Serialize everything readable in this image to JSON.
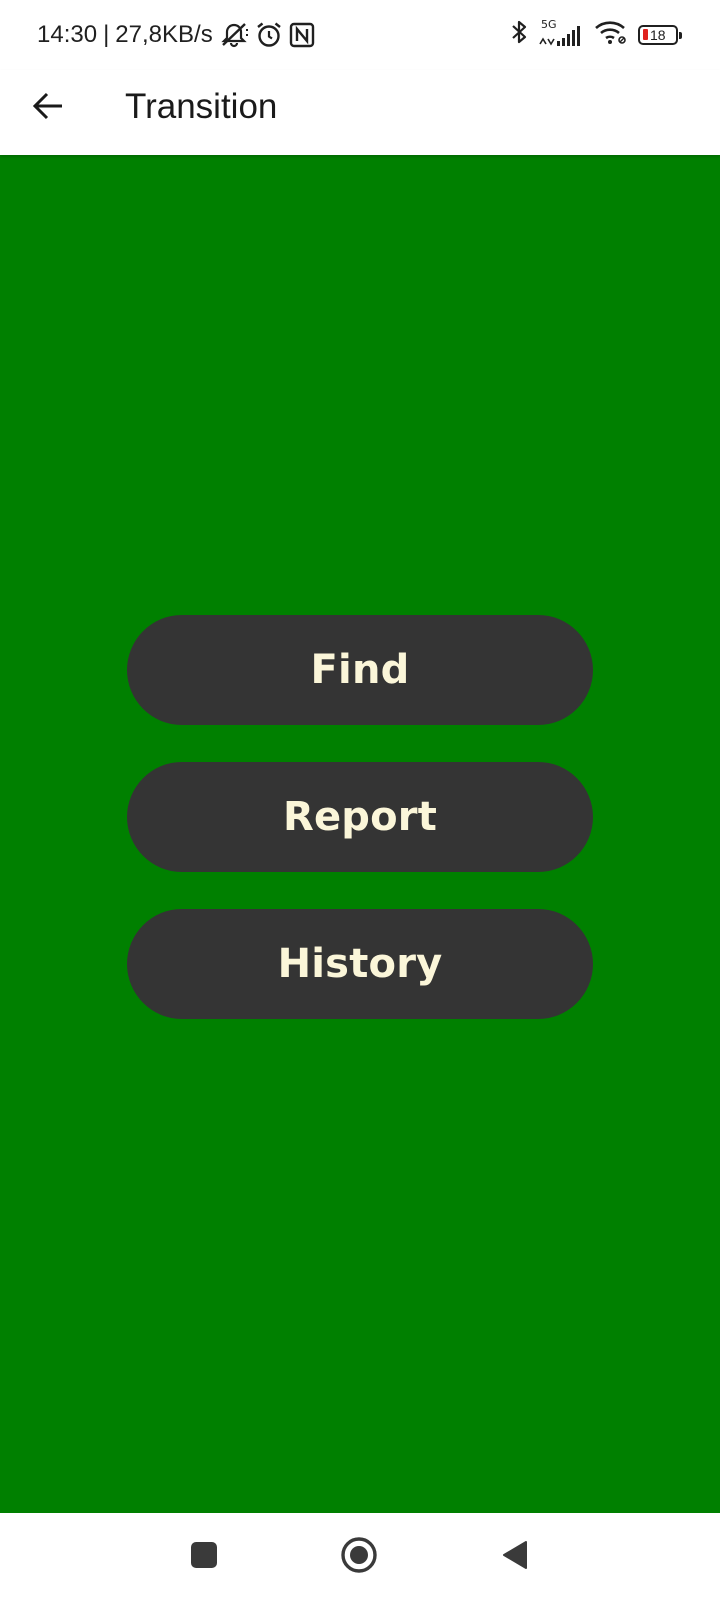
{
  "status_bar": {
    "time": "14:30",
    "separator": "|",
    "net_speed": "27,8KB/s",
    "network_label": "5G",
    "battery_level": "18",
    "battery_color": "#e0221f",
    "icons": [
      "bell-off-icon",
      "alarm-icon",
      "nfc-icon",
      "bluetooth-icon",
      "cell-signal-icon",
      "wifi-icon",
      "battery-icon"
    ]
  },
  "app_bar": {
    "title": "Transition",
    "back_icon": "arrow-left-icon"
  },
  "menu": {
    "background_color": "#008000",
    "button_color": "#343434",
    "text_color": "#fbf6d9",
    "buttons": [
      {
        "label": "Find"
      },
      {
        "label": "Report"
      },
      {
        "label": "History"
      }
    ]
  },
  "nav_bar": {
    "icons": [
      "recent-apps-icon",
      "home-icon",
      "back-icon"
    ]
  }
}
